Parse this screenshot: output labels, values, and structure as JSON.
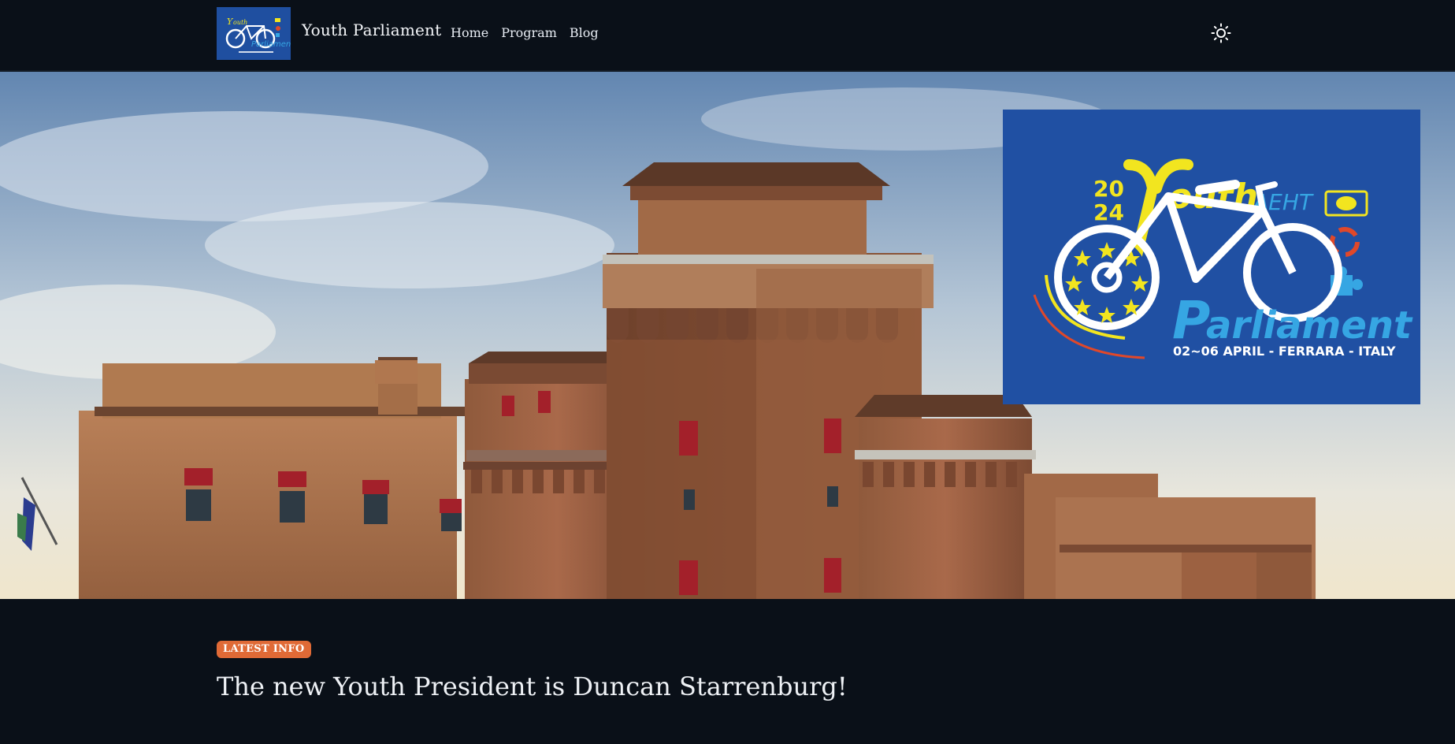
{
  "navbar": {
    "brand_name": "Youth Parliament",
    "links": [
      {
        "label": "Home"
      },
      {
        "label": "Program"
      },
      {
        "label": "Blog"
      }
    ],
    "theme_toggle_icon": "sun-icon"
  },
  "logo": {
    "year_top": "20",
    "year_bottom": "24",
    "word_youth": "outh",
    "org": "AEHT",
    "word_parliament": "arliament",
    "event": "02~06 APRIL - FERRARA - ITALY",
    "colors": {
      "background": "#2050a3",
      "yellow": "#f2e51f",
      "light_blue": "#36a6e3",
      "red": "#e0482a"
    }
  },
  "news": {
    "badge": "LATEST INFO",
    "headline": "The new Youth President is Duncan Starrenburg!"
  },
  "colors": {
    "page_background": "#0a1018",
    "badge": "#e06a36"
  }
}
